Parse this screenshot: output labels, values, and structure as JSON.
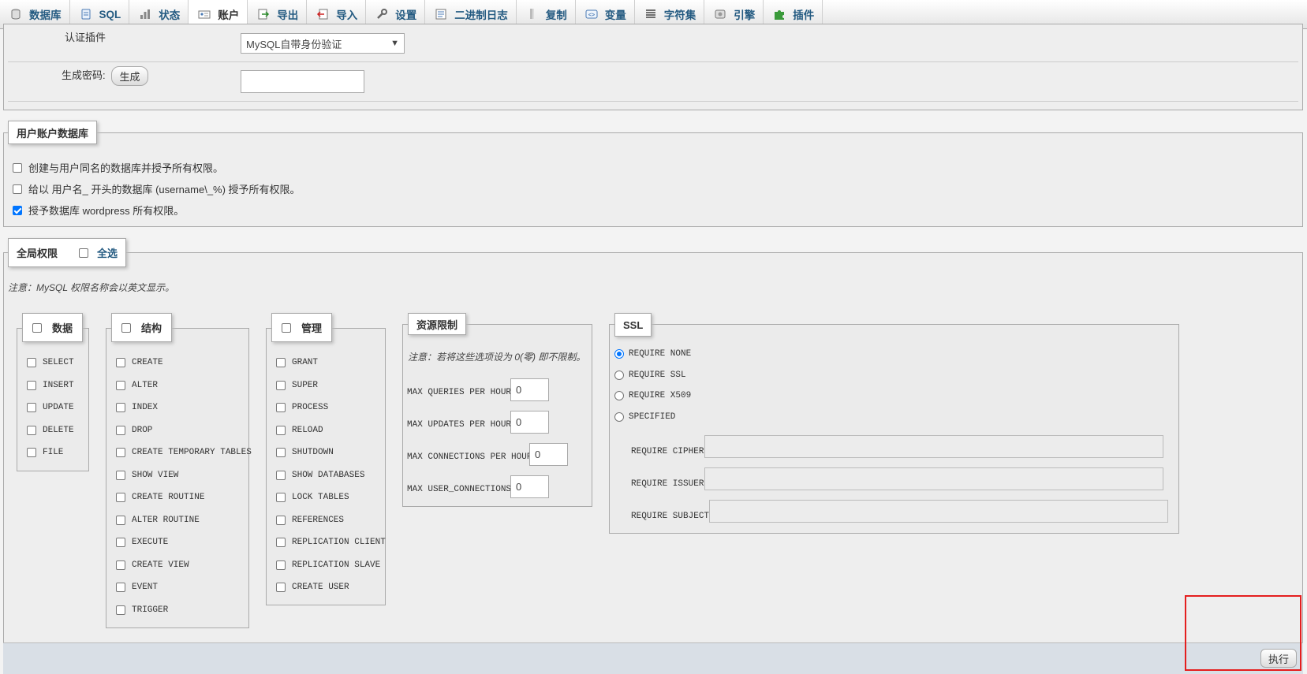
{
  "nav": {
    "tabs": [
      {
        "label": "数据库",
        "icon": "database-icon"
      },
      {
        "label": "SQL",
        "icon": "sql-icon"
      },
      {
        "label": "状态",
        "icon": "status-icon"
      },
      {
        "label": "账户",
        "icon": "accounts-icon"
      },
      {
        "label": "导出",
        "icon": "export-icon"
      },
      {
        "label": "导入",
        "icon": "import-icon"
      },
      {
        "label": "设置",
        "icon": "wrench-icon"
      },
      {
        "label": "二进制日志",
        "icon": "binlog-icon"
      },
      {
        "label": "复制",
        "icon": "replication-icon"
      },
      {
        "label": "变量",
        "icon": "variables-icon"
      },
      {
        "label": "字符集",
        "icon": "charset-icon"
      },
      {
        "label": "引擎",
        "icon": "engine-icon"
      },
      {
        "label": "插件",
        "icon": "puzzle-icon"
      }
    ],
    "active_index": 3
  },
  "login": {
    "auth_plugin_label": "认证插件",
    "auth_plugin_value": "MySQL自带身份验证",
    "gen_password_label": "生成密码:",
    "gen_button": "生成",
    "gen_password_value": ""
  },
  "user_db": {
    "legend": "用户账户数据库",
    "options": [
      {
        "label": "创建与用户同名的数据库并授予所有权限。",
        "checked": false
      },
      {
        "label": "给以 用户名_ 开头的数据库 (username\\_%) 授予所有权限。",
        "checked": false
      },
      {
        "label": "授予数据库 wordpress 所有权限。",
        "checked": true
      }
    ]
  },
  "global": {
    "legend": "全局权限",
    "select_all": "全选",
    "note": "注意：MySQL 权限名称会以英文显示。",
    "data": {
      "legend": "数据",
      "items": [
        "SELECT",
        "INSERT",
        "UPDATE",
        "DELETE",
        "FILE"
      ]
    },
    "structure": {
      "legend": "结构",
      "items": [
        "CREATE",
        "ALTER",
        "INDEX",
        "DROP",
        "CREATE TEMPORARY TABLES",
        "SHOW VIEW",
        "CREATE ROUTINE",
        "ALTER ROUTINE",
        "EXECUTE",
        "CREATE VIEW",
        "EVENT",
        "TRIGGER"
      ]
    },
    "admin": {
      "legend": "管理",
      "items": [
        "GRANT",
        "SUPER",
        "PROCESS",
        "RELOAD",
        "SHUTDOWN",
        "SHOW DATABASES",
        "LOCK TABLES",
        "REFERENCES",
        "REPLICATION CLIENT",
        "REPLICATION SLAVE",
        "CREATE USER"
      ]
    },
    "limits": {
      "legend": "资源限制",
      "note": "注意：若将这些选项设为 0(零) 即不限制。",
      "items": [
        {
          "label": "MAX QUERIES PER HOUR",
          "value": "0"
        },
        {
          "label": "MAX UPDATES PER HOUR",
          "value": "0"
        },
        {
          "label": "MAX CONNECTIONS PER HOUR",
          "value": "0"
        },
        {
          "label": "MAX USER_CONNECTIONS",
          "value": "0"
        }
      ]
    },
    "ssl": {
      "legend": "SSL",
      "options": [
        {
          "label": "REQUIRE NONE",
          "checked": true
        },
        {
          "label": "REQUIRE SSL",
          "checked": false
        },
        {
          "label": "REQUIRE X509",
          "checked": false
        },
        {
          "label": "SPECIFIED",
          "checked": false
        }
      ],
      "fields": [
        {
          "label": "REQUIRE CIPHER",
          "value": ""
        },
        {
          "label": "REQUIRE ISSUER",
          "value": ""
        },
        {
          "label": "REQUIRE SUBJECT",
          "value": ""
        }
      ]
    }
  },
  "footer": {
    "execute": "执行"
  },
  "colors": {
    "link": "#235a81",
    "highlight": "#e41e1e",
    "accent": "#0075ff"
  }
}
